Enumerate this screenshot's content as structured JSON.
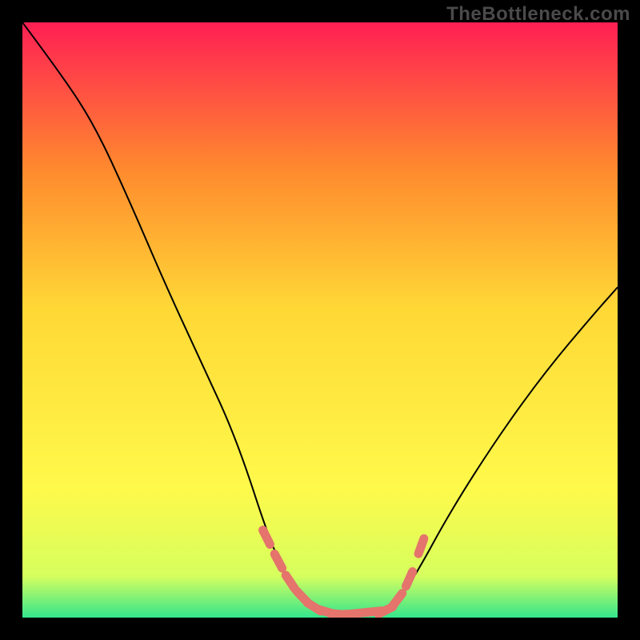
{
  "watermark": "TheBottleneck.com",
  "chart_data": {
    "type": "line",
    "title": "",
    "xlabel": "",
    "ylabel": "",
    "xlim": [
      0,
      1
    ],
    "ylim": [
      0,
      1
    ],
    "grid": false,
    "legend": false,
    "series": [
      {
        "name": "left-descent",
        "x": [
          0.0,
          0.06,
          0.12,
          0.18,
          0.24,
          0.3,
          0.36,
          0.42,
          0.46,
          0.5
        ],
        "values": [
          1.0,
          0.92,
          0.83,
          0.7,
          0.56,
          0.43,
          0.3,
          0.115,
          0.04,
          0.01
        ]
      },
      {
        "name": "valley-floor",
        "x": [
          0.5,
          0.54,
          0.58,
          0.62
        ],
        "values": [
          0.01,
          0.005,
          0.007,
          0.012
        ]
      },
      {
        "name": "right-ascent",
        "x": [
          0.62,
          0.66,
          0.72,
          0.8,
          0.88,
          0.96,
          1.0
        ],
        "values": [
          0.012,
          0.07,
          0.18,
          0.305,
          0.415,
          0.51,
          0.555
        ]
      }
    ],
    "highlighted_points": {
      "name": "markers",
      "x": [
        0.41,
        0.43,
        0.45,
        0.47,
        0.49,
        0.51,
        0.53,
        0.55,
        0.57,
        0.59,
        0.61,
        0.63,
        0.65,
        0.67
      ],
      "values": [
        0.135,
        0.095,
        0.06,
        0.035,
        0.018,
        0.01,
        0.006,
        0.006,
        0.008,
        0.01,
        0.012,
        0.03,
        0.065,
        0.12
      ]
    },
    "background_gradient": {
      "top": "#ff1f54",
      "upper_mid": "#ff8b2e",
      "mid": "#ffd836",
      "lower_mid": "#fff94a",
      "near_bottom": "#d6ff5e",
      "bottom": "#34e58c"
    }
  }
}
